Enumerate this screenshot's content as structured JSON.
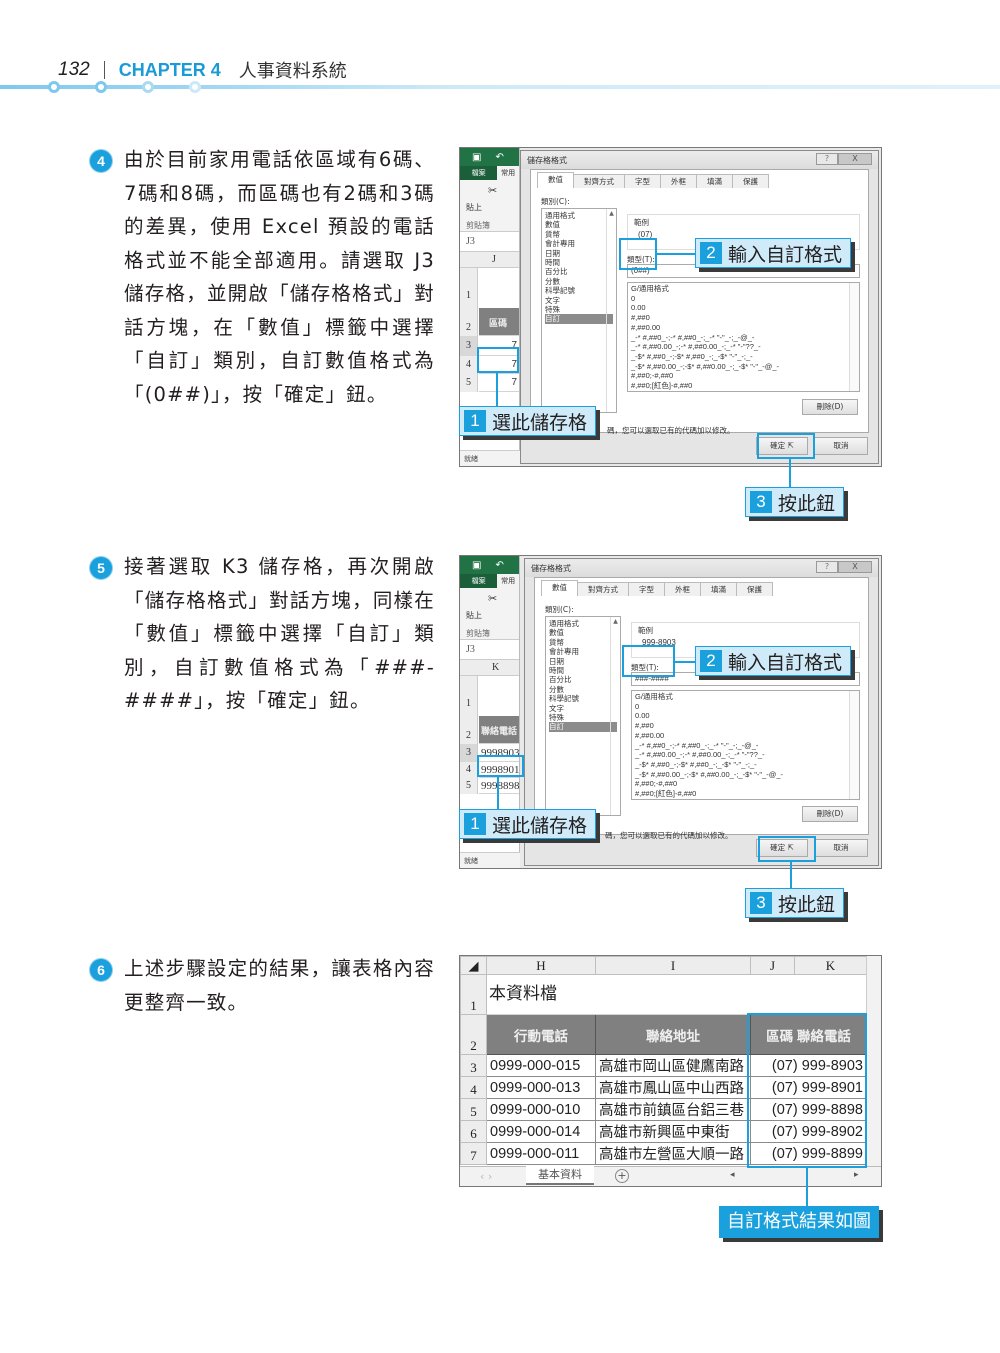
{
  "header": {
    "page_number": "132",
    "chapter_label": "CHAPTER 4",
    "chapter_title": "人事資料系統"
  },
  "steps": [
    {
      "number": "4",
      "text": "由於目前家用電話依區域有6碼、7碼和8碼，而區碼也有2碼和3碼的差異，使用 Excel 預設的電話格式並不能全部適用。請選取 J3 儲存格，並開啟「儲存格格式」對話方塊，在「數值」標籤中選擇「自訂」類別，自訂數值格式為「(0##)」，按「確定」鈕。"
    },
    {
      "number": "5",
      "text": "接著選取 K3 儲存格，再次開啟「儲存格格式」對話方塊，同樣在「數值」標籤中選擇「自訂」類別，自訂數值格式為「###-####」，按「確定」鈕。"
    },
    {
      "number": "6",
      "text": "上述步驟設定的結果，讓表格內容更整齊一致。"
    }
  ],
  "excel": {
    "file_tab": "檔案",
    "home_tab": "常用",
    "paste_label": "貼上",
    "clipboard_label": "剪貼簿",
    "name_box": "J3",
    "status": "就緒"
  },
  "dialog": {
    "title": "儲存格格式",
    "help": "?",
    "close": "X",
    "tabs": [
      "數值",
      "對齊方式",
      "字型",
      "外框",
      "填滿",
      "保護"
    ],
    "category_label": "類別(C):",
    "categories": [
      "通用格式",
      "數值",
      "貨幣",
      "會計專用",
      "日期",
      "時間",
      "百分比",
      "分數",
      "科學記號",
      "文字",
      "特殊",
      "自訂"
    ],
    "selected_category": "自訂",
    "sample_label": "範例",
    "type_label": "類型(T):",
    "formats": [
      "G/通用格式",
      "0",
      "0.00",
      "#,##0",
      "#,##0.00",
      "_-* #,##0_-;-* #,##0_-;_-* \"-\"_-;_-@_-",
      "_-* #,##0.00_-;-* #,##0.00_-;_-* \"-\"??_-",
      "_-$* #,##0_-;-$* #,##0_-;_-$* \"-\"_-;_-",
      "_-$* #,##0.00_-;-$* #,##0.00_-;_-$* \"-\"_-@_-",
      "#,##0;-#,##0",
      "#,##0;[紅色]-#,##0"
    ],
    "delete_button": "刪除(D)",
    "hint": "碼，您可以選取已有的代碼加以修改。",
    "ok_button": "確定",
    "cancel_button": "取消"
  },
  "shot1": {
    "column": "J",
    "header_cell": "區碼",
    "rows": [
      "1",
      "2",
      "3",
      "4",
      "5"
    ],
    "cell_values": [
      "7",
      "7",
      "7"
    ],
    "sample_value": "(07)",
    "type_value": "(0##)"
  },
  "shot2": {
    "column": "K",
    "header_cell": "聯絡電話",
    "rows": [
      "1",
      "2",
      "3",
      "4",
      "5"
    ],
    "cell_values": [
      "9998903",
      "9998901",
      "9998898"
    ],
    "sample_value": "999-8903",
    "type_value": "###-####"
  },
  "callouts": {
    "select_cell": {
      "number": "1",
      "text": "選此儲存格"
    },
    "enter_format": {
      "number": "2",
      "text": "輸入自訂格式"
    },
    "press_button": {
      "number": "3",
      "text": "按此鈕"
    },
    "result": "自訂格式結果如圖"
  },
  "result_sheet": {
    "columns": [
      "H",
      "I",
      "J",
      "K"
    ],
    "title": "本資料檔",
    "headers": [
      "行動電話",
      "聯絡地址",
      "區碼 聯絡電話"
    ],
    "rows": [
      {
        "row": "3",
        "mobile": "0999-000-015",
        "address": "高雄市岡山區健鷹南路",
        "phone": "(07) 999-8903"
      },
      {
        "row": "4",
        "mobile": "0999-000-013",
        "address": "高雄市鳳山區中山西路",
        "phone": "(07) 999-8901"
      },
      {
        "row": "5",
        "mobile": "0999-000-010",
        "address": "高雄市前鎮區台鋁三巷",
        "phone": "(07) 999-8898"
      },
      {
        "row": "6",
        "mobile": "0999-000-014",
        "address": "高雄市新興區中東街",
        "phone": "(07) 999-8902"
      },
      {
        "row": "7",
        "mobile": "0999-000-011",
        "address": "高雄市左營區大順一路",
        "phone": "(07) 999-8899"
      }
    ],
    "sheet_tab": "基本資料",
    "add_sheet": "+"
  }
}
